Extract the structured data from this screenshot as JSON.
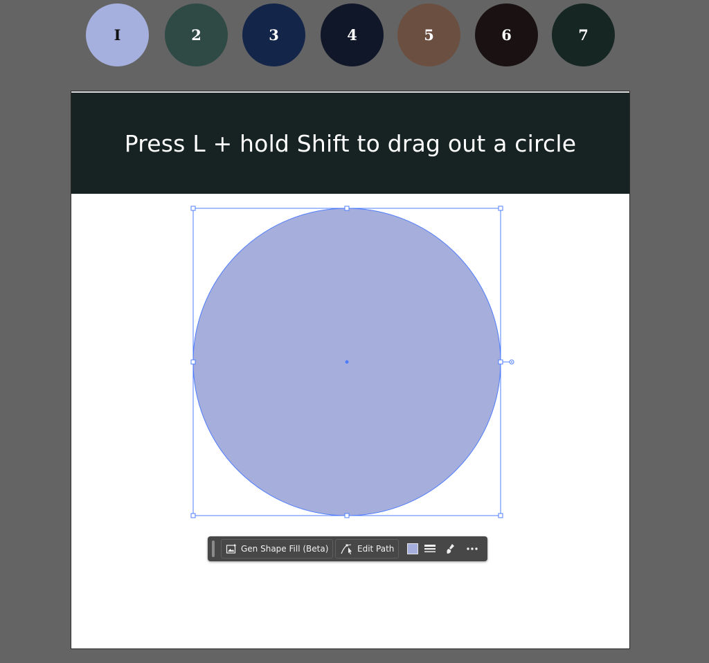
{
  "swatches": [
    {
      "label": "I",
      "color": "#a6b0de",
      "text_color": "#111111"
    },
    {
      "label": "2",
      "color": "#2f4a45",
      "text_color": "#ffffff"
    },
    {
      "label": "3",
      "color": "#14254a",
      "text_color": "#ffffff"
    },
    {
      "label": "4",
      "color": "#101729",
      "text_color": "#ffffff"
    },
    {
      "label": "5",
      "color": "#6b5042",
      "text_color": "#ffffff"
    },
    {
      "label": "6",
      "color": "#1a1212",
      "text_color": "#ffffff"
    },
    {
      "label": "7",
      "color": "#162623",
      "text_color": "#ffffff"
    }
  ],
  "banner": {
    "text": "Press L + hold Shift to drag out a circle",
    "background": "#172322"
  },
  "shape": {
    "type": "circle",
    "fill": "#a6afdc",
    "selection_color": "#4f7cff"
  },
  "toolbar": {
    "gen_shape_fill_label": "Gen Shape Fill (Beta)",
    "edit_path_label": "Edit Path",
    "fill_swatch_color": "#a6afdc",
    "icons": [
      "gen-shape-fill-icon",
      "edit-path-icon",
      "fill-swatch-icon",
      "stroke-weight-icon",
      "recolor-icon",
      "more-options-icon"
    ]
  },
  "canvas_background": "#646464"
}
